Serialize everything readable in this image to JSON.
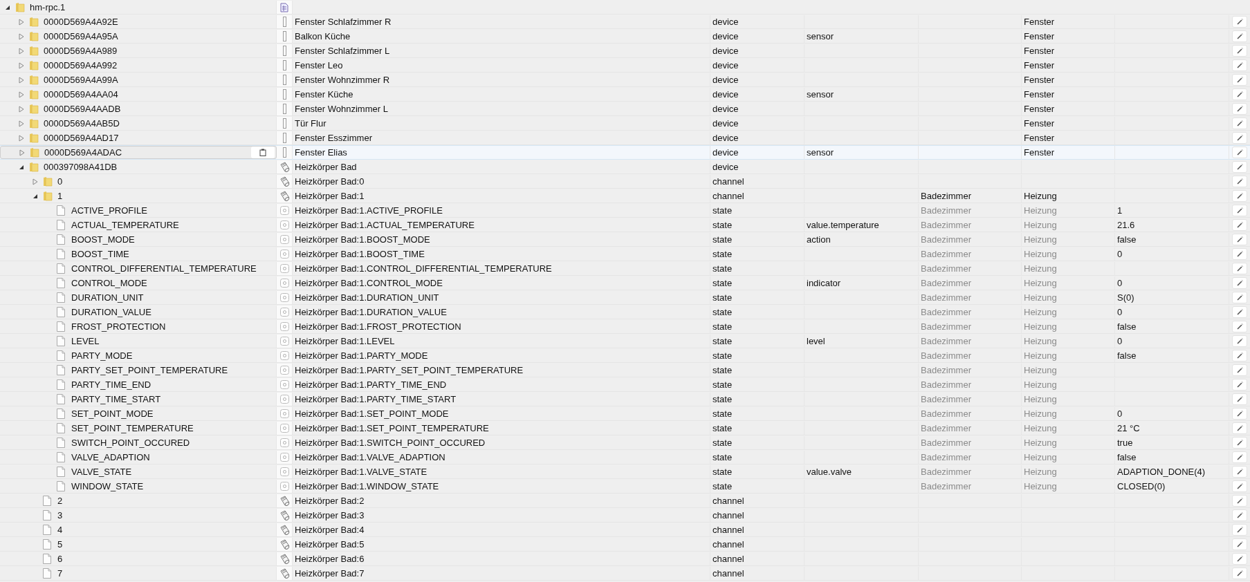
{
  "root": {
    "id": "hm-rpc.1",
    "expanded": true,
    "selected": false,
    "kind": "adapter"
  },
  "nodes": [
    {
      "id": "0000D569A4A92E",
      "kind": "window",
      "name": "Fenster Schlafzimmer R",
      "type": "device",
      "function": "Fenster",
      "expanded": false,
      "selected": false
    },
    {
      "id": "0000D569A4A95A",
      "kind": "window",
      "name": "Balkon Küche",
      "type": "device",
      "role": "sensor",
      "function": "Fenster",
      "expanded": false,
      "selected": false
    },
    {
      "id": "0000D569A4A989",
      "kind": "window",
      "name": "Fenster Schlafzimmer L",
      "type": "device",
      "function": "Fenster",
      "expanded": false,
      "selected": false
    },
    {
      "id": "0000D569A4A992",
      "kind": "window",
      "name": "Fenster Leo",
      "type": "device",
      "function": "Fenster",
      "expanded": false,
      "selected": false
    },
    {
      "id": "0000D569A4A99A",
      "kind": "window",
      "name": "Fenster Wohnzimmer R",
      "type": "device",
      "function": "Fenster",
      "expanded": false,
      "selected": false
    },
    {
      "id": "0000D569A4AA04",
      "kind": "window",
      "name": "Fenster Küche",
      "type": "device",
      "role": "sensor",
      "function": "Fenster",
      "expanded": false,
      "selected": false
    },
    {
      "id": "0000D569A4AADB",
      "kind": "window",
      "name": "Fenster Wohnzimmer L",
      "type": "device",
      "function": "Fenster",
      "expanded": false,
      "selected": false
    },
    {
      "id": "0000D569A4AB5D",
      "kind": "window",
      "name": "Tür Flur",
      "type": "device",
      "function": "Fenster",
      "expanded": false,
      "selected": false
    },
    {
      "id": "0000D569A4AD17",
      "kind": "window",
      "name": "Fenster Esszimmer",
      "type": "device",
      "function": "Fenster",
      "expanded": false,
      "selected": false
    },
    {
      "id": "0000D569A4ADAC",
      "kind": "window",
      "name": "Fenster Elias",
      "type": "device",
      "role": "sensor",
      "function": "Fenster",
      "expanded": false,
      "selected": true
    },
    {
      "id": "000397098A41DB",
      "kind": "thermostat",
      "name": "Heizkörper Bad",
      "type": "device",
      "expanded": true,
      "selected": false,
      "children": [
        {
          "id": "0",
          "kind": "thermostat",
          "name": "Heizkörper Bad:0",
          "type": "channel",
          "expanded": false,
          "selected": false
        },
        {
          "id": "1",
          "kind": "thermostat",
          "name": "Heizkörper Bad:1",
          "type": "channel",
          "room": "Badezimmer",
          "function": "Heizung",
          "inherited": false,
          "expanded": true,
          "selected": false,
          "children": [
            {
              "id": "ACTIVE_PROFILE",
              "kind": "state",
              "name": "Heizkörper Bad:1.ACTIVE_PROFILE",
              "type": "state",
              "room": "Badezimmer",
              "function": "Heizung",
              "inherited": true,
              "value": "1",
              "selected": false
            },
            {
              "id": "ACTUAL_TEMPERATURE",
              "kind": "state",
              "name": "Heizkörper Bad:1.ACTUAL_TEMPERATURE",
              "type": "state",
              "role": "value.temperature",
              "room": "Badezimmer",
              "function": "Heizung",
              "inherited": true,
              "value": "21.6",
              "selected": false
            },
            {
              "id": "BOOST_MODE",
              "kind": "state",
              "name": "Heizkörper Bad:1.BOOST_MODE",
              "type": "state",
              "role": "action",
              "room": "Badezimmer",
              "function": "Heizung",
              "inherited": true,
              "value": "false",
              "selected": false
            },
            {
              "id": "BOOST_TIME",
              "kind": "state",
              "name": "Heizkörper Bad:1.BOOST_TIME",
              "type": "state",
              "room": "Badezimmer",
              "function": "Heizung",
              "inherited": true,
              "value": "0",
              "selected": false
            },
            {
              "id": "CONTROL_DIFFERENTIAL_TEMPERATURE",
              "kind": "state",
              "name": "Heizkörper Bad:1.CONTROL_DIFFERENTIAL_TEMPERATURE",
              "type": "state",
              "room": "Badezimmer",
              "function": "Heizung",
              "inherited": true,
              "selected": false
            },
            {
              "id": "CONTROL_MODE",
              "kind": "state",
              "name": "Heizkörper Bad:1.CONTROL_MODE",
              "type": "state",
              "role": "indicator",
              "room": "Badezimmer",
              "function": "Heizung",
              "inherited": true,
              "value": "0",
              "selected": false
            },
            {
              "id": "DURATION_UNIT",
              "kind": "state",
              "name": "Heizkörper Bad:1.DURATION_UNIT",
              "type": "state",
              "room": "Badezimmer",
              "function": "Heizung",
              "inherited": true,
              "value": "S(0)",
              "selected": false
            },
            {
              "id": "DURATION_VALUE",
              "kind": "state",
              "name": "Heizkörper Bad:1.DURATION_VALUE",
              "type": "state",
              "room": "Badezimmer",
              "function": "Heizung",
              "inherited": true,
              "value": "0",
              "selected": false
            },
            {
              "id": "FROST_PROTECTION",
              "kind": "state",
              "name": "Heizkörper Bad:1.FROST_PROTECTION",
              "type": "state",
              "room": "Badezimmer",
              "function": "Heizung",
              "inherited": true,
              "value": "false",
              "selected": false
            },
            {
              "id": "LEVEL",
              "kind": "state",
              "name": "Heizkörper Bad:1.LEVEL",
              "type": "state",
              "role": "level",
              "room": "Badezimmer",
              "function": "Heizung",
              "inherited": true,
              "value": "0",
              "selected": false
            },
            {
              "id": "PARTY_MODE",
              "kind": "state",
              "name": "Heizkörper Bad:1.PARTY_MODE",
              "type": "state",
              "room": "Badezimmer",
              "function": "Heizung",
              "inherited": true,
              "value": "false",
              "selected": false
            },
            {
              "id": "PARTY_SET_POINT_TEMPERATURE",
              "kind": "state",
              "name": "Heizkörper Bad:1.PARTY_SET_POINT_TEMPERATURE",
              "type": "state",
              "room": "Badezimmer",
              "function": "Heizung",
              "inherited": true,
              "selected": false
            },
            {
              "id": "PARTY_TIME_END",
              "kind": "state",
              "name": "Heizkörper Bad:1.PARTY_TIME_END",
              "type": "state",
              "room": "Badezimmer",
              "function": "Heizung",
              "inherited": true,
              "selected": false
            },
            {
              "id": "PARTY_TIME_START",
              "kind": "state",
              "name": "Heizkörper Bad:1.PARTY_TIME_START",
              "type": "state",
              "room": "Badezimmer",
              "function": "Heizung",
              "inherited": true,
              "selected": false
            },
            {
              "id": "SET_POINT_MODE",
              "kind": "state",
              "name": "Heizkörper Bad:1.SET_POINT_MODE",
              "type": "state",
              "room": "Badezimmer",
              "function": "Heizung",
              "inherited": true,
              "value": "0",
              "selected": false
            },
            {
              "id": "SET_POINT_TEMPERATURE",
              "kind": "state",
              "name": "Heizkörper Bad:1.SET_POINT_TEMPERATURE",
              "type": "state",
              "room": "Badezimmer",
              "function": "Heizung",
              "inherited": true,
              "value": "21 °C",
              "selected": false
            },
            {
              "id": "SWITCH_POINT_OCCURED",
              "kind": "state",
              "name": "Heizkörper Bad:1.SWITCH_POINT_OCCURED",
              "type": "state",
              "room": "Badezimmer",
              "function": "Heizung",
              "inherited": true,
              "value": "true",
              "selected": false
            },
            {
              "id": "VALVE_ADAPTION",
              "kind": "state",
              "name": "Heizkörper Bad:1.VALVE_ADAPTION",
              "type": "state",
              "room": "Badezimmer",
              "function": "Heizung",
              "inherited": true,
              "value": "false",
              "selected": false
            },
            {
              "id": "VALVE_STATE",
              "kind": "state",
              "name": "Heizkörper Bad:1.VALVE_STATE",
              "type": "state",
              "role": "value.valve",
              "room": "Badezimmer",
              "function": "Heizung",
              "inherited": true,
              "value": "ADAPTION_DONE(4)",
              "selected": false
            },
            {
              "id": "WINDOW_STATE",
              "kind": "state",
              "name": "Heizkörper Bad:1.WINDOW_STATE",
              "type": "state",
              "room": "Badezimmer",
              "function": "Heizung",
              "inherited": true,
              "value": "CLOSED(0)",
              "selected": false
            }
          ]
        },
        {
          "id": "2",
          "kind": "thermostat",
          "name": "Heizkörper Bad:2",
          "type": "channel",
          "selected": false
        },
        {
          "id": "3",
          "kind": "thermostat",
          "name": "Heizkörper Bad:3",
          "type": "channel",
          "selected": false
        },
        {
          "id": "4",
          "kind": "thermostat",
          "name": "Heizkörper Bad:4",
          "type": "channel",
          "selected": false
        },
        {
          "id": "5",
          "kind": "thermostat",
          "name": "Heizkörper Bad:5",
          "type": "channel",
          "selected": false
        },
        {
          "id": "6",
          "kind": "thermostat",
          "name": "Heizkörper Bad:6",
          "type": "channel",
          "selected": false
        },
        {
          "id": "7",
          "kind": "thermostat",
          "name": "Heizkörper Bad:7",
          "type": "channel",
          "selected": false
        }
      ]
    }
  ]
}
